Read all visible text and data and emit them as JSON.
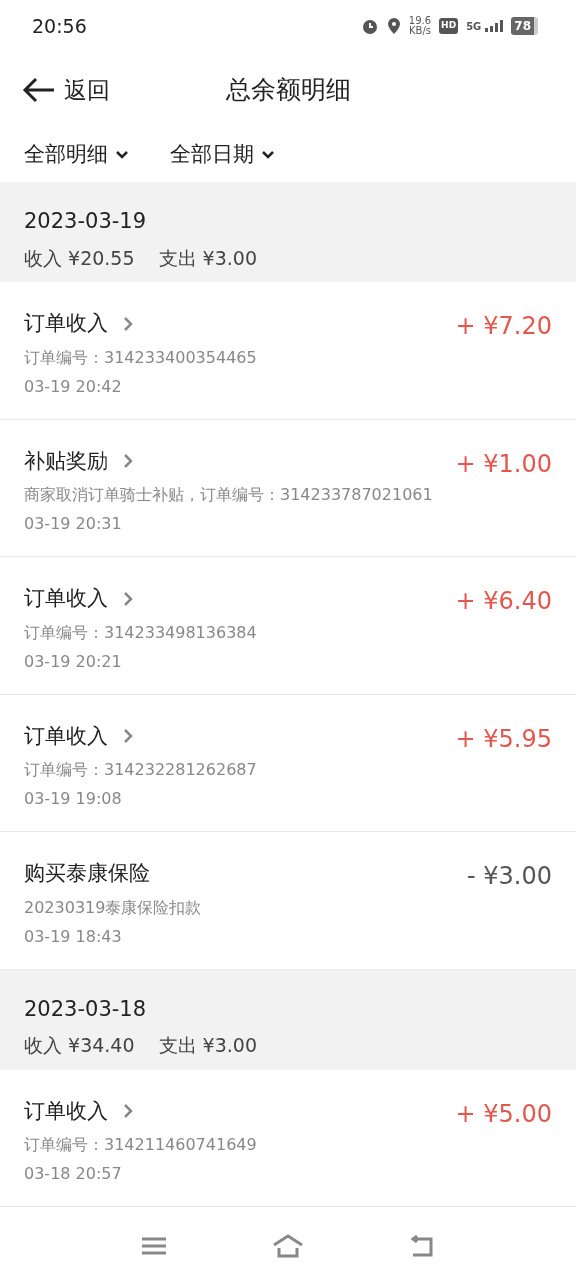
{
  "status_bar": {
    "time": "20:56",
    "speed": "19.6",
    "speed_unit": "KB/s",
    "hd": "HD",
    "network": "5G",
    "battery": "78"
  },
  "header": {
    "back": "返回",
    "title": "总余额明细"
  },
  "filters": [
    {
      "label": "全部明细"
    },
    {
      "label": "全部日期"
    }
  ],
  "groups": [
    {
      "date": "2023-03-19",
      "income": "收入 ¥20.55",
      "expense": "支出 ¥3.00",
      "items": [
        {
          "kind": "income",
          "title": "订单收入",
          "detail": "订单编号：314233400354465",
          "time": "03-19 20:42",
          "amount": "+ ¥7.20"
        },
        {
          "kind": "income",
          "title": "补贴奖励",
          "detail": "商家取消订单骑士补贴，订单编号：314233787021061",
          "time": "03-19 20:31",
          "amount": "+ ¥1.00"
        },
        {
          "kind": "income",
          "title": "订单收入",
          "detail": "订单编号：314233498136384",
          "time": "03-19 20:21",
          "amount": "+ ¥6.40"
        },
        {
          "kind": "income",
          "title": "订单收入",
          "detail": "订单编号：314232281262687",
          "time": "03-19 19:08",
          "amount": "+ ¥5.95"
        },
        {
          "kind": "expense",
          "title": "购买泰康保险",
          "detail": "20230319泰康保险扣款",
          "time": "03-19 18:43",
          "amount": "- ¥3.00"
        }
      ]
    },
    {
      "date": "2023-03-18",
      "income": "收入 ¥34.40",
      "expense": "支出 ¥3.00",
      "items": [
        {
          "kind": "income",
          "title": "订单收入",
          "detail": "订单编号：314211460741649",
          "time": "03-18 20:57",
          "amount": "+ ¥5.00"
        }
      ]
    }
  ]
}
